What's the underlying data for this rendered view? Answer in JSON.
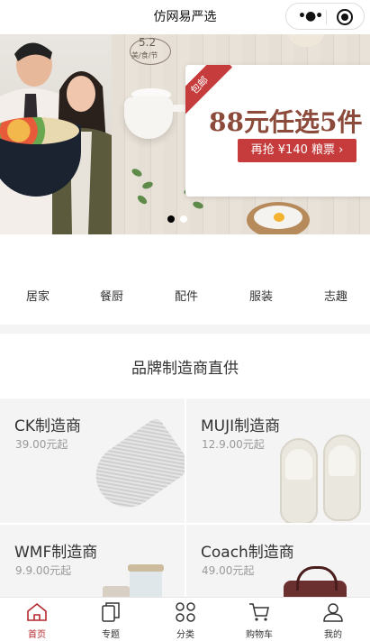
{
  "navbar": {
    "title": "仿网易严选"
  },
  "banner": {
    "date_badge": "5.2",
    "date_sub": "美/食/节",
    "ribbon": "包邮",
    "headline": "88元任选5件",
    "cta": "再抢 ¥140 粮票 ›"
  },
  "categories": [
    "居家",
    "餐厨",
    "配件",
    "服装",
    "志趣"
  ],
  "brand": {
    "title": "品牌制造商直供",
    "items": [
      {
        "name": "CK制造商",
        "price": "39.00元起"
      },
      {
        "name": "MUJI制造商",
        "price": "12.9.00元起"
      },
      {
        "name": "WMF制造商",
        "price": "9.9.00元起"
      },
      {
        "name": "Coach制造商",
        "price": "49.00元起"
      }
    ]
  },
  "tabbar": {
    "items": [
      {
        "label": "首页",
        "icon": "home-icon",
        "active": true
      },
      {
        "label": "专题",
        "icon": "topic-icon"
      },
      {
        "label": "分类",
        "icon": "category-icon"
      },
      {
        "label": "购物车",
        "icon": "cart-icon"
      },
      {
        "label": "我的",
        "icon": "user-icon"
      }
    ]
  },
  "colors": {
    "accent": "#b4282d",
    "tile_bg": "#f4f4f4",
    "banner_red": "#c63c3c"
  }
}
